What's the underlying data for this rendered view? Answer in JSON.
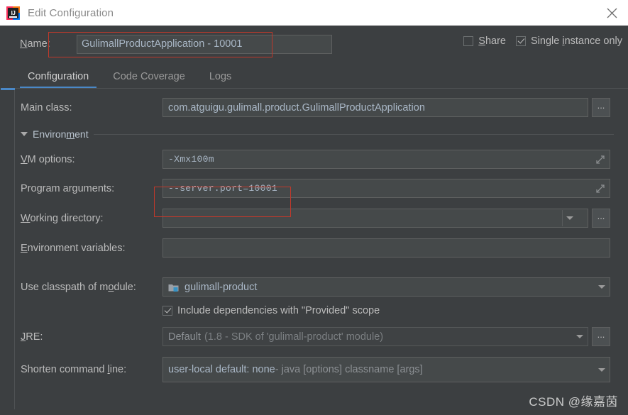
{
  "window": {
    "title": "Edit Configuration",
    "app_icon": "intellij-idea-icon",
    "logo_text": "IJ",
    "close_icon": "close-icon"
  },
  "name_row": {
    "label": "Name:",
    "label_mnemonic": "N",
    "value": "GulimallProductApplication - 10001",
    "share": {
      "label": "Share",
      "mnemonic": "S",
      "checked": false
    },
    "single_instance": {
      "label": "Single instance only",
      "mnemonic": "i",
      "checked": true
    }
  },
  "tabs": [
    {
      "label": "Configuration",
      "active": true
    },
    {
      "label": "Code Coverage",
      "active": false
    },
    {
      "label": "Logs",
      "active": false
    }
  ],
  "fields": {
    "main_class": {
      "label": "Main class:",
      "value": "com.atguigu.gulimall.product.GulimallProductApplication",
      "browse_label": "..."
    },
    "environment_section": {
      "title": "Environment",
      "mnemonic": "m",
      "expanded": true
    },
    "vm_options": {
      "label": "VM options:",
      "mnemonic": "V",
      "value": "-Xmx100m",
      "expand_icon": "expand-icon"
    },
    "program_arguments": {
      "label": "Program arguments:",
      "mnemonic": "g",
      "value": "--server.port=10001",
      "expand_icon": "expand-icon"
    },
    "working_directory": {
      "label": "Working directory:",
      "mnemonic": "W",
      "value": "",
      "browse_label": "...",
      "dropdown_icon": "chevron-down-icon"
    },
    "environment_variables": {
      "label": "Environment variables:",
      "mnemonic": "E",
      "value": "",
      "folder_icon": "folder-icon"
    },
    "classpath_module": {
      "label": "Use classpath of module:",
      "mnemonic": "o",
      "value": "gulimall-product",
      "module_icon": "module-folder-icon",
      "dropdown_icon": "chevron-down-icon"
    },
    "include_provided": {
      "label": "Include dependencies with \"Provided\" scope",
      "checked": true
    },
    "jre": {
      "label": "JRE:",
      "mnemonic": "J",
      "value": "Default",
      "value_hint": "(1.8 - SDK of 'gulimall-product' module)",
      "browse_label": "...",
      "dropdown_icon": "chevron-down-icon"
    },
    "shorten_command_line": {
      "label": "Shorten command line:",
      "mnemonic": "l",
      "value_main": "user-local default: none",
      "value_rest": " - java [options] classname [args]",
      "dropdown_icon": "chevron-down-icon"
    }
  },
  "annotations": [
    {
      "name": "name-field-highlight"
    },
    {
      "name": "program-arguments-highlight"
    }
  ],
  "watermark": {
    "text": "CSDN @缘嘉茵"
  },
  "colors": {
    "background": "#3c3f41",
    "field_background": "#45494a",
    "text": "#bbbbbb",
    "value_text": "#a9b7c6",
    "accent_tab": "#4a88c7",
    "annotation_red": "#c0392b",
    "module_icon_blue": "#3592c4",
    "titlebar_background": "#ffffff"
  }
}
